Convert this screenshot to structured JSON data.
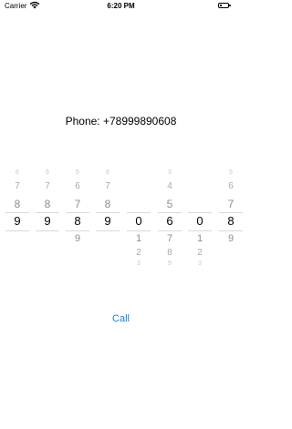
{
  "status_bar": {
    "carrier": "Carrier",
    "time": "6:20 PM"
  },
  "phone": {
    "label": "Phone: +78999890608"
  },
  "picker": {
    "columns": [
      {
        "m3": "6",
        "m2": "7",
        "m1": "8",
        "selected": "9",
        "p1": "",
        "p2": "",
        "p3": ""
      },
      {
        "m3": "6",
        "m2": "7",
        "m1": "8",
        "selected": "9",
        "p1": "",
        "p2": "",
        "p3": ""
      },
      {
        "m3": "5",
        "m2": "6",
        "m1": "7",
        "selected": "8",
        "p1": "9",
        "p2": "",
        "p3": ""
      },
      {
        "m3": "6",
        "m2": "7",
        "m1": "8",
        "selected": "9",
        "p1": "",
        "p2": "",
        "p3": ""
      },
      {
        "m3": "",
        "m2": "",
        "m1": "",
        "selected": "0",
        "p1": "1",
        "p2": "2",
        "p3": "3"
      },
      {
        "m3": "3",
        "m2": "4",
        "m1": "5",
        "selected": "6",
        "p1": "7",
        "p2": "8",
        "p3": "9"
      },
      {
        "m3": "",
        "m2": "",
        "m1": "",
        "selected": "0",
        "p1": "1",
        "p2": "2",
        "p3": "3"
      },
      {
        "m3": "5",
        "m2": "6",
        "m1": "7",
        "selected": "8",
        "p1": "9",
        "p2": "",
        "p3": ""
      }
    ]
  },
  "call": {
    "label": "Call"
  }
}
